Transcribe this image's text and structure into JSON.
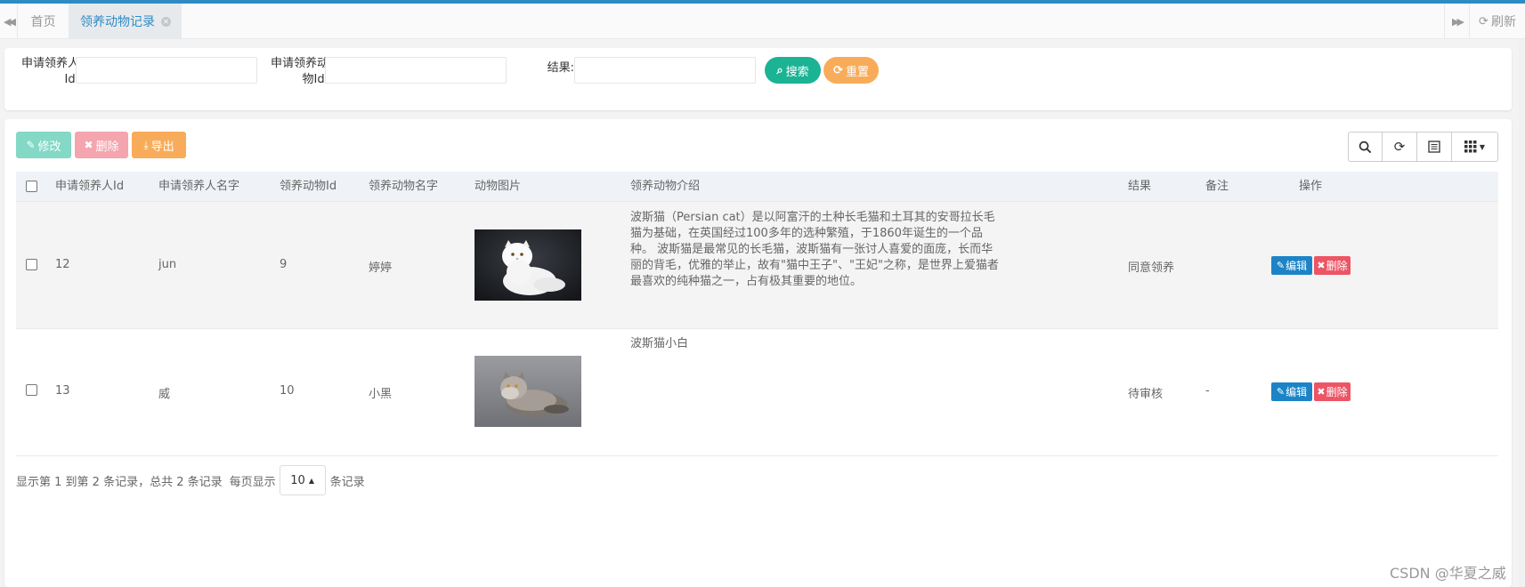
{
  "tabbar": {
    "home_label": "首页",
    "active_label": "领养动物记录",
    "refresh_label": "刷新"
  },
  "search": {
    "applicant_id_label": "申请领养人Id:",
    "animal_id_label": "申请领养动物Id:",
    "result_label": "结果:",
    "applicant_id_value": "",
    "animal_id_value": "",
    "result_value": "",
    "search_button": "搜索",
    "reset_button": "重置"
  },
  "toolbar": {
    "edit_label": "修改",
    "delete_label": "删除",
    "export_label": "导出"
  },
  "table": {
    "columns": [
      "申请领养人Id",
      "申请领养人名字",
      "领养动物Id",
      "领养动物名字",
      "动物图片",
      "领养动物介绍",
      "结果",
      "备注",
      "操作"
    ],
    "rows": [
      {
        "applicant_id": "12",
        "applicant_name": "jun",
        "animal_id": "9",
        "animal_name": "婷婷",
        "image": "white-persian-cat",
        "intro": "波斯猫（Persian cat）是以阿富汗的土种长毛猫和土耳其的安哥拉长毛猫为基础，在英国经过100多年的选种繁殖，于1860年诞生的一个品种。 波斯猫是最常见的长毛猫，波斯猫有一张讨人喜爱的面庞，长而华丽的背毛，优雅的举止，故有\"猫中王子\"、\"王妃\"之称，是世界上爱猫者最喜欢的纯种猫之一，占有极其重要的地位。",
        "result": "同意领养",
        "remark": "",
        "edit": "编辑",
        "delete": "删除"
      },
      {
        "applicant_id": "13",
        "applicant_name": "威",
        "animal_id": "10",
        "animal_name": "小黑",
        "image": "grey-persian-cat",
        "intro": "波斯猫小白",
        "result": "待审核",
        "remark": "-",
        "edit": "编辑",
        "delete": "删除"
      }
    ]
  },
  "pager": {
    "summary": "显示第 1 到第 2 条记录，总共 2 条记录",
    "per_page_prefix": "每页显示",
    "page_size": "10",
    "per_page_suffix": "条记录"
  },
  "watermark": "CSDN @华夏之威",
  "colors": {
    "accent": "#2f8bc4",
    "green": "#1ab394",
    "orange": "#f8ac59",
    "blue": "#1c84c6",
    "red": "#ed5565"
  }
}
